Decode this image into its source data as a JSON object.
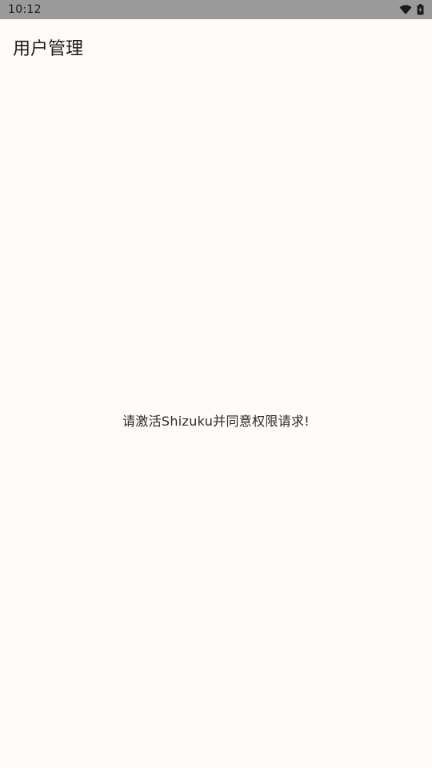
{
  "status_bar": {
    "time": "10:12",
    "icons": [
      "wifi-icon",
      "battery-icon"
    ]
  },
  "app": {
    "title": "用户管理"
  },
  "main": {
    "message": "请激活Shizuku并同意权限请求!"
  },
  "colors": {
    "background": "#fffbf9",
    "status_bar": "#9a9a9a",
    "text": "#1d1b1b"
  }
}
